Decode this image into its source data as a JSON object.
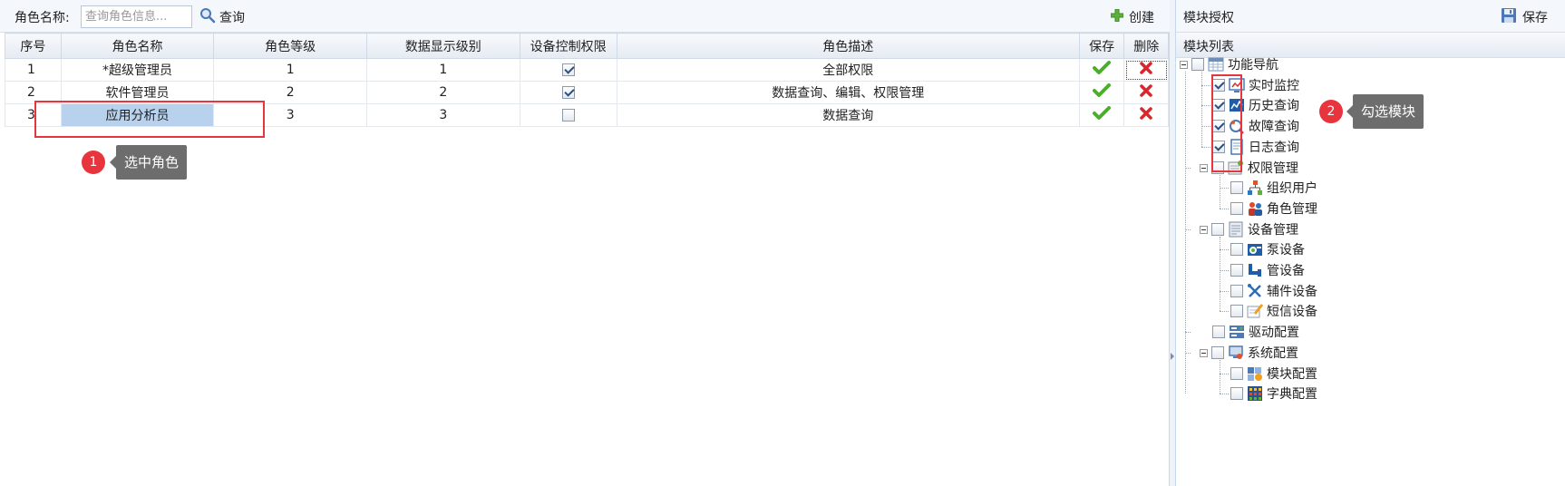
{
  "toolbar": {
    "role_name_label": "角色名称:",
    "search_placeholder": "查询角色信息...",
    "search_label": "查询",
    "create_label": "创建"
  },
  "table": {
    "headers": [
      "序号",
      "角色名称",
      "角色等级",
      "数据显示级别",
      "设备控制权限",
      "角色描述",
      "保存",
      "删除"
    ],
    "rows": [
      {
        "index": "1",
        "name": "*超级管理员",
        "level": "1",
        "display_level": "1",
        "device_control": true,
        "description": "全部权限",
        "selected": false
      },
      {
        "index": "2",
        "name": "软件管理员",
        "level": "2",
        "display_level": "2",
        "device_control": true,
        "description": "数据查询、编辑、权限管理",
        "selected": false
      },
      {
        "index": "3",
        "name": "应用分析员",
        "level": "3",
        "display_level": "3",
        "device_control": false,
        "description": "数据查询",
        "selected": true
      }
    ]
  },
  "annotations": {
    "step1_number": "1",
    "step1_text": "选中角色",
    "step2_number": "2",
    "step2_text": "勾选模块"
  },
  "right_panel": {
    "title": "模块授权",
    "save_label": "保存",
    "subheader": "模块列表",
    "tree": {
      "root": {
        "label": "功能导航",
        "icon": "grid-icon",
        "checked": false
      },
      "nav_children": [
        {
          "label": "实时监控",
          "icon": "monitor-icon",
          "checked": true
        },
        {
          "label": "历史查询",
          "icon": "chart-icon",
          "checked": true
        },
        {
          "label": "故障查询",
          "icon": "fault-icon",
          "checked": true
        },
        {
          "label": "日志查询",
          "icon": "log-icon",
          "checked": true
        }
      ],
      "groups": [
        {
          "label": "权限管理",
          "icon": "permission-icon",
          "checked": false,
          "children": [
            {
              "label": "组织用户",
              "icon": "org-icon",
              "checked": false
            },
            {
              "label": "角色管理",
              "icon": "roles-icon",
              "checked": false
            }
          ]
        },
        {
          "label": "设备管理",
          "icon": "device-icon",
          "checked": false,
          "children": [
            {
              "label": "泵设备",
              "icon": "pump-icon",
              "checked": false
            },
            {
              "label": "管设备",
              "icon": "pipe-icon",
              "checked": false
            },
            {
              "label": "辅件设备",
              "icon": "tools-icon",
              "checked": false
            },
            {
              "label": "短信设备",
              "icon": "sms-icon",
              "checked": false
            }
          ]
        },
        {
          "label": "驱动配置",
          "icon": "driver-icon",
          "checked": false,
          "children": []
        },
        {
          "label": "系统配置",
          "icon": "system-icon",
          "checked": false,
          "children": [
            {
              "label": "模块配置",
              "icon": "module-icon",
              "checked": false
            },
            {
              "label": "字典配置",
              "icon": "dictionary-icon",
              "checked": false
            }
          ]
        }
      ]
    }
  },
  "colors": {
    "accent_red": "#e8343c",
    "selected_cell": "#b8d2ee",
    "tooltip_bg": "#6d6d6d",
    "save_green": "#4caf2a",
    "delete_red": "#d9262b"
  }
}
